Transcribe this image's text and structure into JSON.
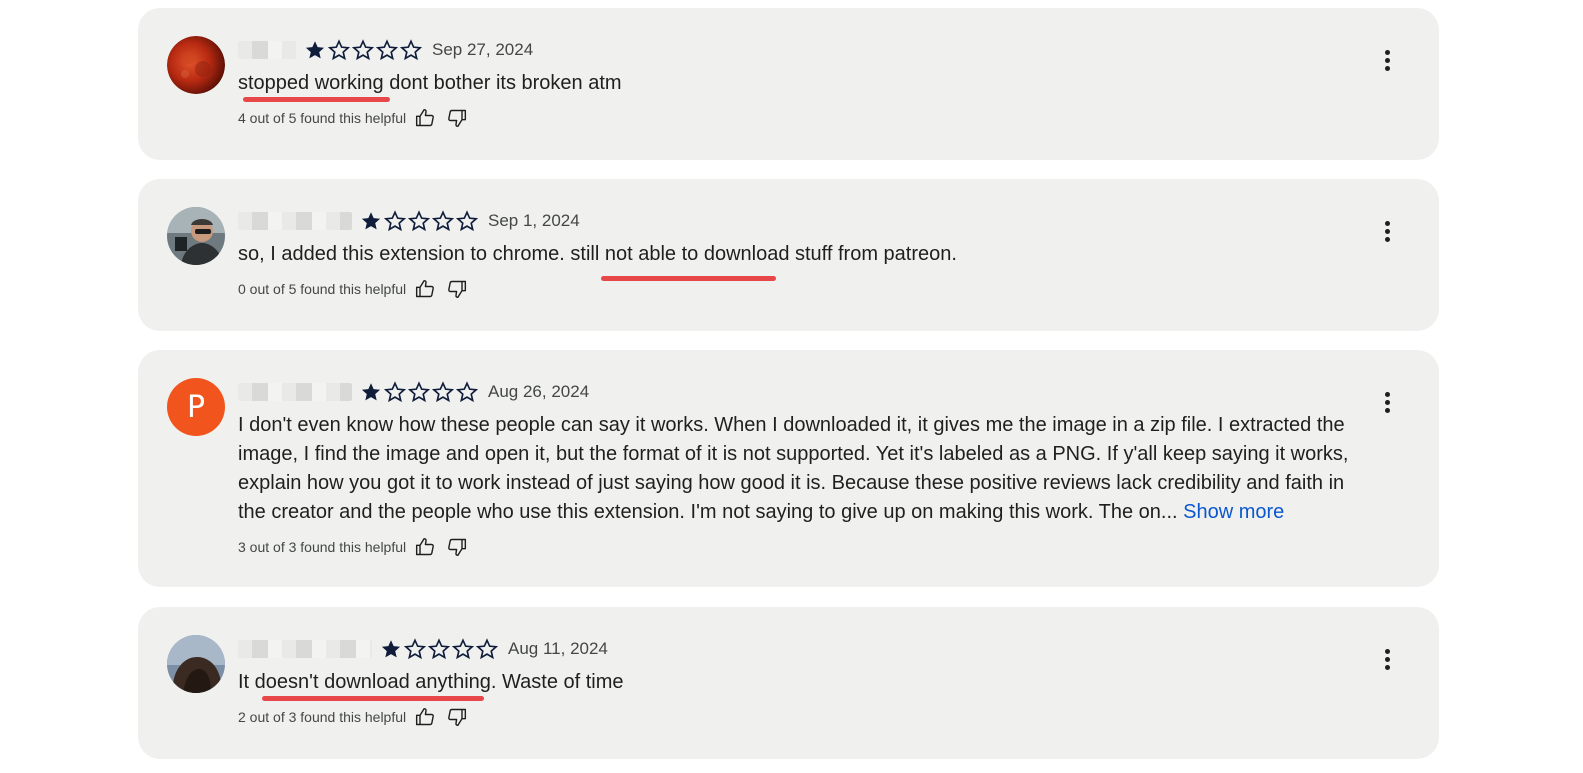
{
  "theme": {
    "card_bg": "#f0f1ef",
    "star_color": "#0f1d3b",
    "link_color": "#0b57d0",
    "underline_color": "#e8474a",
    "avatar_letter_bg": "#f2541d"
  },
  "reviews": [
    {
      "rating": 1,
      "max_rating": 5,
      "date": "Sep 27, 2024",
      "text": "stopped working dont bother its broken atm",
      "helpful": "4 out of 5 found this helpful",
      "avatar": "moon-photo"
    },
    {
      "rating": 1,
      "max_rating": 5,
      "date": "Sep 1, 2024",
      "text": "so, I added this extension to chrome. still not able to download stuff from patreon.",
      "helpful": "0 out of 5 found this helpful",
      "avatar": "person-photo"
    },
    {
      "rating": 1,
      "max_rating": 5,
      "date": "Aug 26, 2024",
      "text": "I don't even know how these people can say it works. When I downloaded it, it gives me the image in a zip file. I extracted the image, I find the image and open it, but the format of it is not supported. Yet it's labeled as a PNG. If y'all keep saying it works, explain how you got it to work instead of just saying how good it is. Because these positive reviews lack credibility and faith in the creator and the people who use this extension. I'm not saying to give up on making this work. The on...",
      "show_more": "Show more",
      "helpful": "3 out of 3 found this helpful",
      "avatar_letter": "P"
    },
    {
      "rating": 1,
      "max_rating": 5,
      "date": "Aug 11, 2024",
      "text": "It doesn't download anything. Waste of time",
      "helpful": "2 out of 3 found this helpful",
      "avatar": "hair-photo"
    }
  ]
}
